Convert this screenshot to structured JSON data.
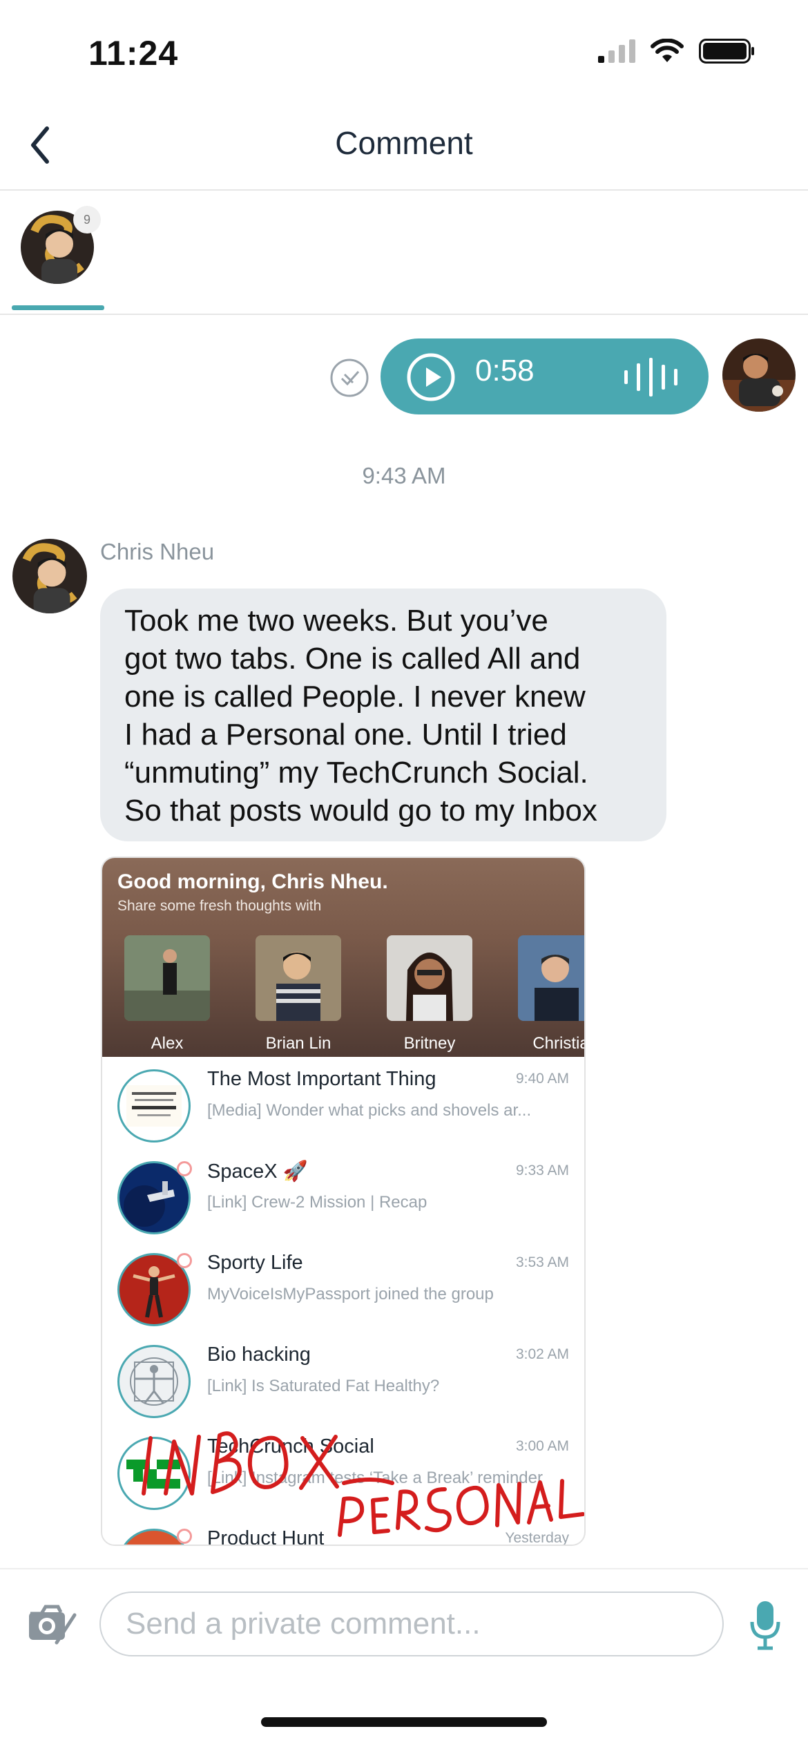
{
  "status_bar": {
    "time": "11:24"
  },
  "header": {
    "title": "Comment"
  },
  "tabs": {
    "badge": "9"
  },
  "voice_message": {
    "duration": "0:58"
  },
  "timestamp": "9:43 AM",
  "message": {
    "sender": "Chris Nheu",
    "lines": [
      "Took me two weeks. But you’ve",
      "got two tabs. One is called All and",
      "one is called People. I never knew",
      "I had a Personal one. Until I tried",
      "“unmuting” my TechCrunch Social.",
      "So that posts would go to my Inbox"
    ]
  },
  "card": {
    "greeting": "Good morning, Chris Nheu.",
    "subtitle": "Share some fresh thoughts with",
    "people": [
      "Alex",
      "Brian Lin",
      "Britney",
      "Christia"
    ],
    "rows": [
      {
        "name": "The Most Important Thing",
        "time": "9:40 AM",
        "preview": "[Media] Wonder what picks and shovels ar..."
      },
      {
        "name": "SpaceX 🚀",
        "time": "9:33 AM",
        "preview": "[Link] Crew-2 Mission | Recap"
      },
      {
        "name": "Sporty Life",
        "time": "3:53 AM",
        "preview": "MyVoiceIsMyPassport joined the group"
      },
      {
        "name": "Bio hacking",
        "time": "3:02 AM",
        "preview": "[Link] Is Saturated Fat Healthy?"
      },
      {
        "name": "TechCrunch Social",
        "time": "3:00 AM",
        "preview": "[Link] Instagram tests ‘Take a Break’ reminder"
      },
      {
        "name": "Product Hunt",
        "time": "Yesterday",
        "preview": ""
      }
    ],
    "icon_text": {
      "book": "The MOST IMPORTANT THING ILLUMINATED",
      "tc": "TechCrunch"
    },
    "annotations": {
      "inbox": "INBOX",
      "personal": "PERSONAL"
    }
  },
  "composer": {
    "placeholder": "Send a private comment..."
  },
  "colors": {
    "accent": "#4aa8b1",
    "annotation": "#d41d1d"
  },
  "icons": [
    "back-chevron-icon",
    "signal-icon",
    "wifi-icon",
    "battery-icon",
    "sent-check-icon",
    "play-icon",
    "waveform-icon",
    "camera-icon",
    "mic-icon"
  ]
}
